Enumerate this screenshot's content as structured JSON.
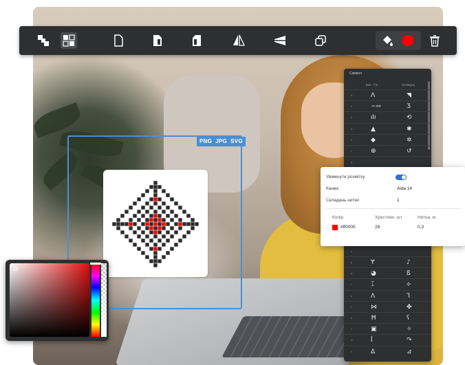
{
  "toolbar": {
    "buttons": [
      {
        "name": "tool-select-pattern",
        "icon": "diagonal-squares-icon",
        "active": false
      },
      {
        "name": "tool-select-inverse",
        "icon": "diagonal-squares-outline-icon",
        "active": true
      },
      {
        "name": "new-page",
        "icon": "page-icon"
      },
      {
        "name": "page-right",
        "icon": "page-half-right-icon"
      },
      {
        "name": "page-left",
        "icon": "page-half-left-icon"
      },
      {
        "name": "mirror",
        "icon": "mirror-triangles-icon"
      },
      {
        "name": "perspective",
        "icon": "perspective-icon"
      },
      {
        "name": "duplicate",
        "icon": "duplicate-icon"
      },
      {
        "name": "fill",
        "icon": "paint-bucket-icon"
      },
      {
        "name": "fill-color",
        "icon": "red-octagon-icon"
      },
      {
        "name": "delete",
        "icon": "trash-icon"
      }
    ],
    "fill_color": "#ff0000"
  },
  "export_formats": [
    "PNG",
    "JPG",
    "SVG"
  ],
  "accent_color": "#4a8fd4",
  "symbols_panel": {
    "title": "Символ",
    "header_a": "Без · Гік",
    "header_b": "Оглянуть",
    "rows": [
      {
        "idx": "a",
        "a": "ᐱ",
        "b": "◥"
      },
      {
        "idx": "b",
        "a": "∽∾",
        "b": "Ʒ"
      },
      {
        "idx": "c",
        "a": "ılı",
        "b": "⟲"
      },
      {
        "idx": "d",
        "a": "▲",
        "b": "✱"
      },
      {
        "idx": "e",
        "a": "◆",
        "b": "✲"
      },
      {
        "idx": "f",
        "a": "⊕",
        "b": "↺"
      },
      {
        "idx": "g",
        "a": "",
        "b": ""
      },
      {
        "idx": "h",
        "a": "",
        "b": ""
      },
      {
        "idx": "i",
        "a": "",
        "b": ""
      },
      {
        "idx": "j",
        "a": "",
        "b": ""
      },
      {
        "idx": "k",
        "a": "",
        "b": ""
      },
      {
        "idx": "l",
        "a": "",
        "b": ""
      },
      {
        "idx": "m",
        "a": "",
        "b": ""
      },
      {
        "idx": "n",
        "a": "",
        "b": ""
      },
      {
        "idx": "o",
        "a": "",
        "b": ""
      },
      {
        "idx": "p",
        "a": "Ɏ",
        "b": "♪"
      },
      {
        "idx": "q",
        "a": "◕",
        "b": "ß"
      },
      {
        "idx": "r",
        "a": "⌶",
        "b": "⟡"
      },
      {
        "idx": "s",
        "a": "ᐱ",
        "b": "ꓶ"
      },
      {
        "idx": "t",
        "a": "⋈",
        "b": "✤"
      },
      {
        "idx": "u",
        "a": "Ħ",
        "b": "ʕ"
      },
      {
        "idx": "v",
        "a": "▣",
        "b": "✧"
      },
      {
        "idx": "w",
        "a": "ꟾ",
        "b": "↷"
      },
      {
        "idx": "x",
        "a": "ᐃ",
        "b": "⊿"
      }
    ]
  },
  "settings": {
    "show_grid_label": "Увімкнути розмітку",
    "show_grid_on": true,
    "canvas_label": "Канва",
    "canvas_value": "Aida 14",
    "threads_label": "Складань нитки",
    "threads_value": "1",
    "table": {
      "col_color": "Колір",
      "col_stitches": "Хрестики, шт",
      "col_thread": "Нитка, м",
      "swatch_color": "#ff0000",
      "color_value": "#ff0000",
      "stitches_value": "28",
      "thread_value": "0,3"
    }
  }
}
